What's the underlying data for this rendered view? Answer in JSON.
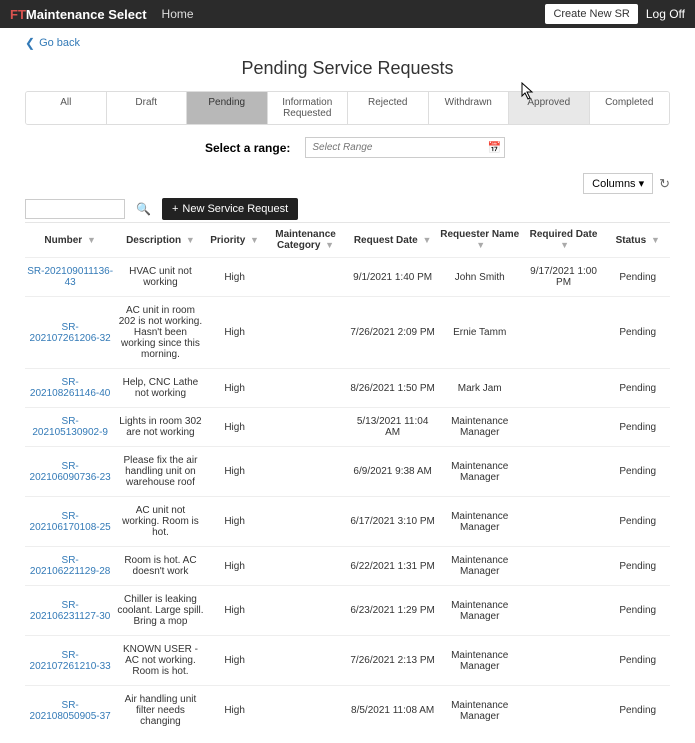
{
  "navbar": {
    "brand_prefix": "FT",
    "brand_rest": "Maintenance Select",
    "home": "Home",
    "create_sr": "Create New SR",
    "logoff": "Log Off"
  },
  "goback": "Go back",
  "page_title": "Pending Service Requests",
  "tabs": [
    "All",
    "Draft",
    "Pending",
    "Information Requested",
    "Rejected",
    "Withdrawn",
    "Approved",
    "Completed"
  ],
  "active_tab_index": 2,
  "hover_tab_index": 6,
  "range_label": "Select a range:",
  "range_placeholder": "Select Range",
  "columns_label": "Columns",
  "new_sr_label": "New Service Request",
  "columns": [
    "Number",
    "Description",
    "Priority",
    "Maintenance Category",
    "Request Date",
    "Requester Name",
    "Required Date",
    "Status"
  ],
  "rows": [
    {
      "number": "SR-202109011136-43",
      "desc": "HVAC unit not working",
      "priority": "High",
      "cat": "",
      "reqdate": "9/1/2021 1:40 PM",
      "name": "John Smith",
      "reqd": "9/17/2021 1:00 PM",
      "status": "Pending"
    },
    {
      "number": "SR-202107261206-32",
      "desc": "AC unit in room 202 is not working. Hasn't been working since this morning.",
      "priority": "High",
      "cat": "",
      "reqdate": "7/26/2021 2:09 PM",
      "name": "Ernie Tamm",
      "reqd": "",
      "status": "Pending"
    },
    {
      "number": "SR-202108261146-40",
      "desc": "Help, CNC Lathe not working",
      "priority": "High",
      "cat": "",
      "reqdate": "8/26/2021 1:50 PM",
      "name": "Mark Jam",
      "reqd": "",
      "status": "Pending"
    },
    {
      "number": "SR-202105130902-9",
      "desc": "Lights in room 302 are not working",
      "priority": "High",
      "cat": "",
      "reqdate": "5/13/2021 11:04 AM",
      "name": "Maintenance Manager",
      "reqd": "",
      "status": "Pending"
    },
    {
      "number": "SR-202106090736-23",
      "desc": "Please fix the air handling unit on warehouse roof",
      "priority": "High",
      "cat": "",
      "reqdate": "6/9/2021 9:38 AM",
      "name": "Maintenance Manager",
      "reqd": "",
      "status": "Pending"
    },
    {
      "number": "SR-202106170108-25",
      "desc": "AC unit not working. Room is hot.",
      "priority": "High",
      "cat": "",
      "reqdate": "6/17/2021 3:10 PM",
      "name": "Maintenance Manager",
      "reqd": "",
      "status": "Pending"
    },
    {
      "number": "SR-202106221129-28",
      "desc": "Room is hot. AC doesn't work",
      "priority": "High",
      "cat": "",
      "reqdate": "6/22/2021 1:31 PM",
      "name": "Maintenance Manager",
      "reqd": "",
      "status": "Pending"
    },
    {
      "number": "SR-202106231127-30",
      "desc": "Chiller is leaking coolant. Large spill. Bring a mop",
      "priority": "High",
      "cat": "",
      "reqdate": "6/23/2021 1:29 PM",
      "name": "Maintenance Manager",
      "reqd": "",
      "status": "Pending"
    },
    {
      "number": "SR-202107261210-33",
      "desc": "KNOWN USER - AC not working. Room is hot.",
      "priority": "High",
      "cat": "",
      "reqdate": "7/26/2021 2:13 PM",
      "name": "Maintenance Manager",
      "reqd": "",
      "status": "Pending"
    },
    {
      "number": "SR-202108050905-37",
      "desc": "Air handling unit filter needs changing",
      "priority": "High",
      "cat": "",
      "reqdate": "8/5/2021 11:08 AM",
      "name": "Maintenance Manager",
      "reqd": "",
      "status": "Pending"
    }
  ]
}
